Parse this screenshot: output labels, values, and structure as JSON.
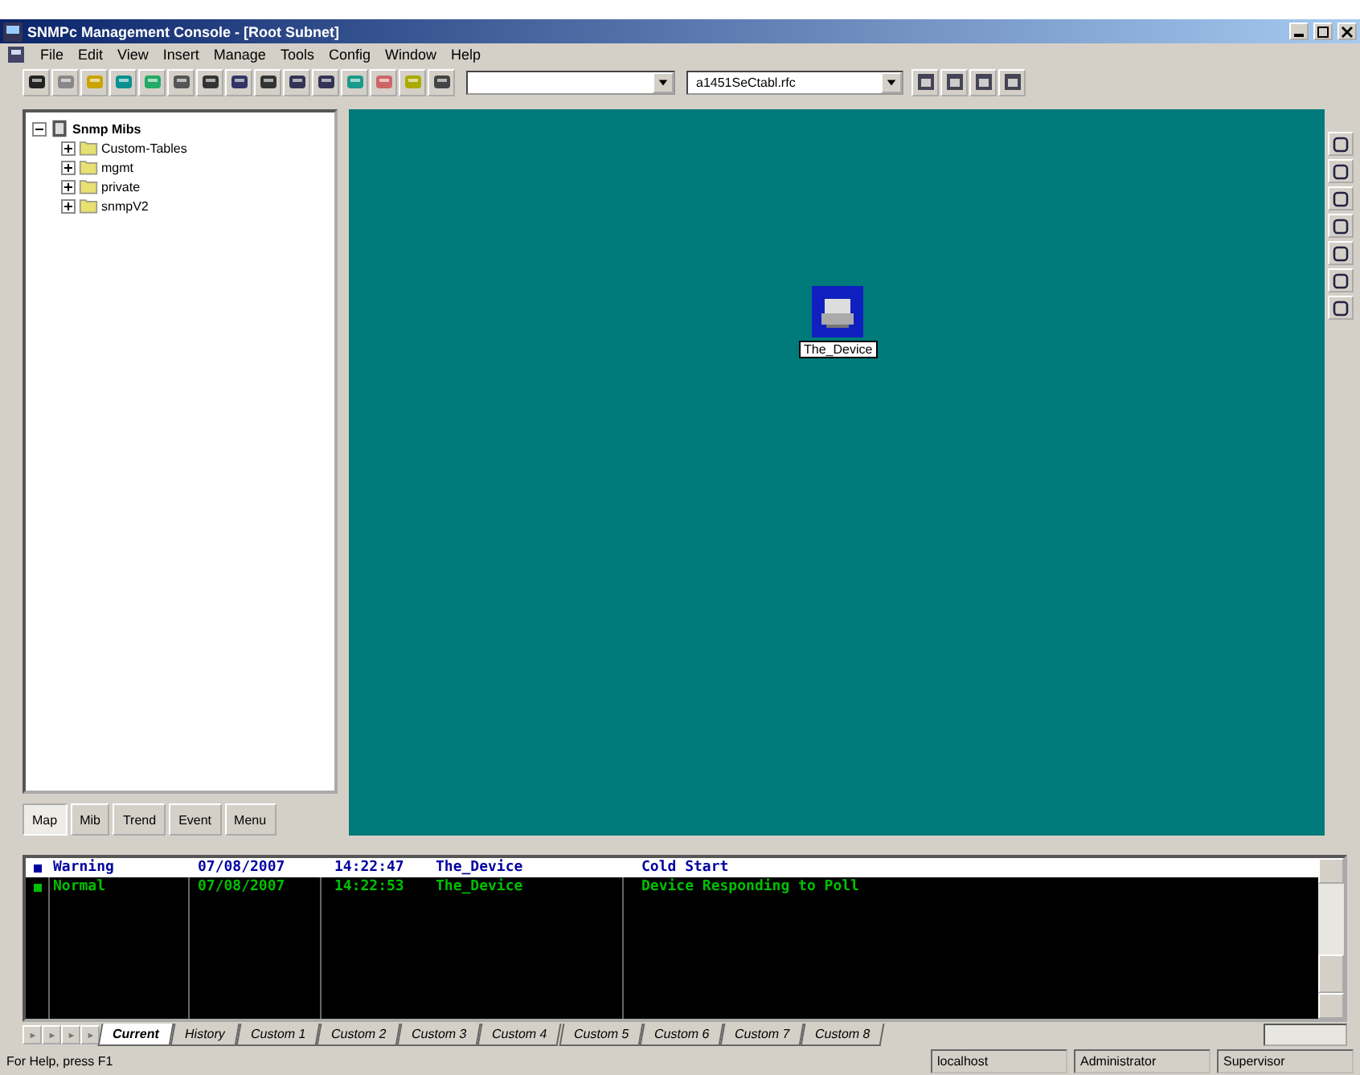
{
  "window": {
    "title": "SNMPc Management Console - [Root Subnet]"
  },
  "menu": [
    "File",
    "Edit",
    "View",
    "Insert",
    "Manage",
    "Tools",
    "Config",
    "Window",
    "Help"
  ],
  "toolbar": {
    "map_combo": "a1451SeCtabl.rfc"
  },
  "tree": {
    "label": "Snmp Mibs",
    "expanded": true,
    "children": [
      {
        "label": "Custom-Tables",
        "expanded": false
      },
      {
        "label": "mgmt",
        "expanded": false
      },
      {
        "label": "private",
        "expanded": false
      },
      {
        "label": "snmpV2",
        "expanded": false
      }
    ]
  },
  "left_tabs": [
    {
      "label": "Map",
      "selected": true
    },
    {
      "label": "Mib",
      "selected": false
    },
    {
      "label": "Trend",
      "selected": false
    },
    {
      "label": "Event",
      "selected": false
    },
    {
      "label": "Menu",
      "selected": false
    }
  ],
  "map": {
    "nodes": [
      {
        "label": "The_Device"
      }
    ]
  },
  "events": [
    {
      "severity": "Warning",
      "date": "07/08/2007",
      "time": "14:22:47",
      "device": "The_Device",
      "message": "Cold Start",
      "selected": true
    },
    {
      "severity": "Normal",
      "date": "07/08/2007",
      "time": "14:22:53",
      "device": "The_Device",
      "message": "Device Responding to Poll",
      "selected": false
    }
  ],
  "event_tabs": [
    {
      "label": "Current",
      "selected": true
    },
    {
      "label": "History",
      "selected": false
    },
    {
      "label": "Custom 1",
      "selected": false
    },
    {
      "label": "Custom 2",
      "selected": false
    },
    {
      "label": "Custom 3",
      "selected": false
    },
    {
      "label": "Custom 4",
      "selected": false
    },
    {
      "label": "Custom 5",
      "selected": false
    },
    {
      "label": "Custom 6",
      "selected": false
    },
    {
      "label": "Custom 7",
      "selected": false
    },
    {
      "label": "Custom 8",
      "selected": false
    }
  ],
  "status_bar": {
    "help": "For Help, press F1",
    "server": "localhost",
    "user": "Administrator",
    "role": "Supervisor"
  }
}
